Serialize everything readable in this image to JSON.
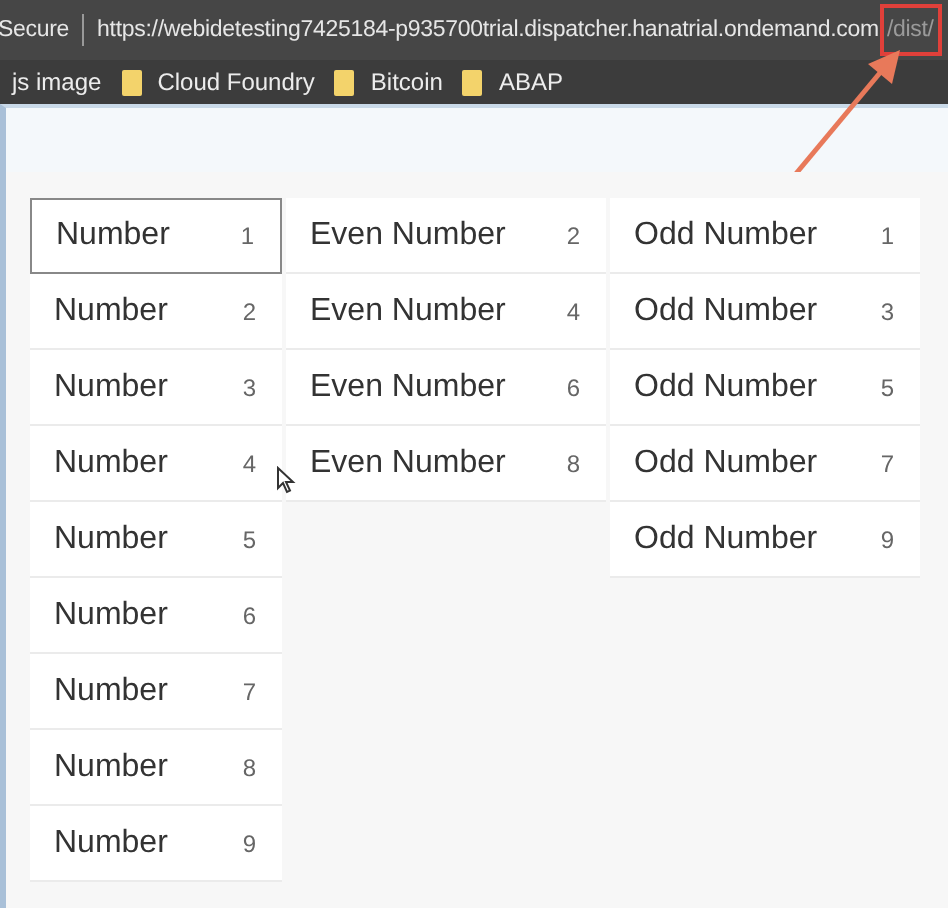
{
  "address_bar": {
    "security": "Secure",
    "url_host": "https://webidetesting7425184-p935700trial.dispatcher.hanatrial.ondemand.com",
    "url_path": "/dist/"
  },
  "bookmarks": [
    {
      "label": "js image",
      "kind": "page"
    },
    {
      "label": "Cloud Foundry",
      "kind": "folder"
    },
    {
      "label": "Bitcoin",
      "kind": "folder"
    },
    {
      "label": "ABAP",
      "kind": "folder"
    }
  ],
  "lists": [
    {
      "items": [
        {
          "title": "Number",
          "counter": "1",
          "focused": true
        },
        {
          "title": "Number",
          "counter": "2",
          "focused": false
        },
        {
          "title": "Number",
          "counter": "3",
          "focused": false
        },
        {
          "title": "Number",
          "counter": "4",
          "focused": false
        },
        {
          "title": "Number",
          "counter": "5",
          "focused": false
        },
        {
          "title": "Number",
          "counter": "6",
          "focused": false
        },
        {
          "title": "Number",
          "counter": "7",
          "focused": false
        },
        {
          "title": "Number",
          "counter": "8",
          "focused": false
        },
        {
          "title": "Number",
          "counter": "9",
          "focused": false
        }
      ]
    },
    {
      "items": [
        {
          "title": "Even Number",
          "counter": "2",
          "focused": false
        },
        {
          "title": "Even Number",
          "counter": "4",
          "focused": false
        },
        {
          "title": "Even Number",
          "counter": "6",
          "focused": false
        },
        {
          "title": "Even Number",
          "counter": "8",
          "focused": false
        }
      ]
    },
    {
      "items": [
        {
          "title": "Odd Number",
          "counter": "1",
          "focused": false
        },
        {
          "title": "Odd Number",
          "counter": "3",
          "focused": false
        },
        {
          "title": "Odd Number",
          "counter": "5",
          "focused": false
        },
        {
          "title": "Odd Number",
          "counter": "7",
          "focused": false
        },
        {
          "title": "Odd Number",
          "counter": "9",
          "focused": false
        }
      ]
    }
  ]
}
